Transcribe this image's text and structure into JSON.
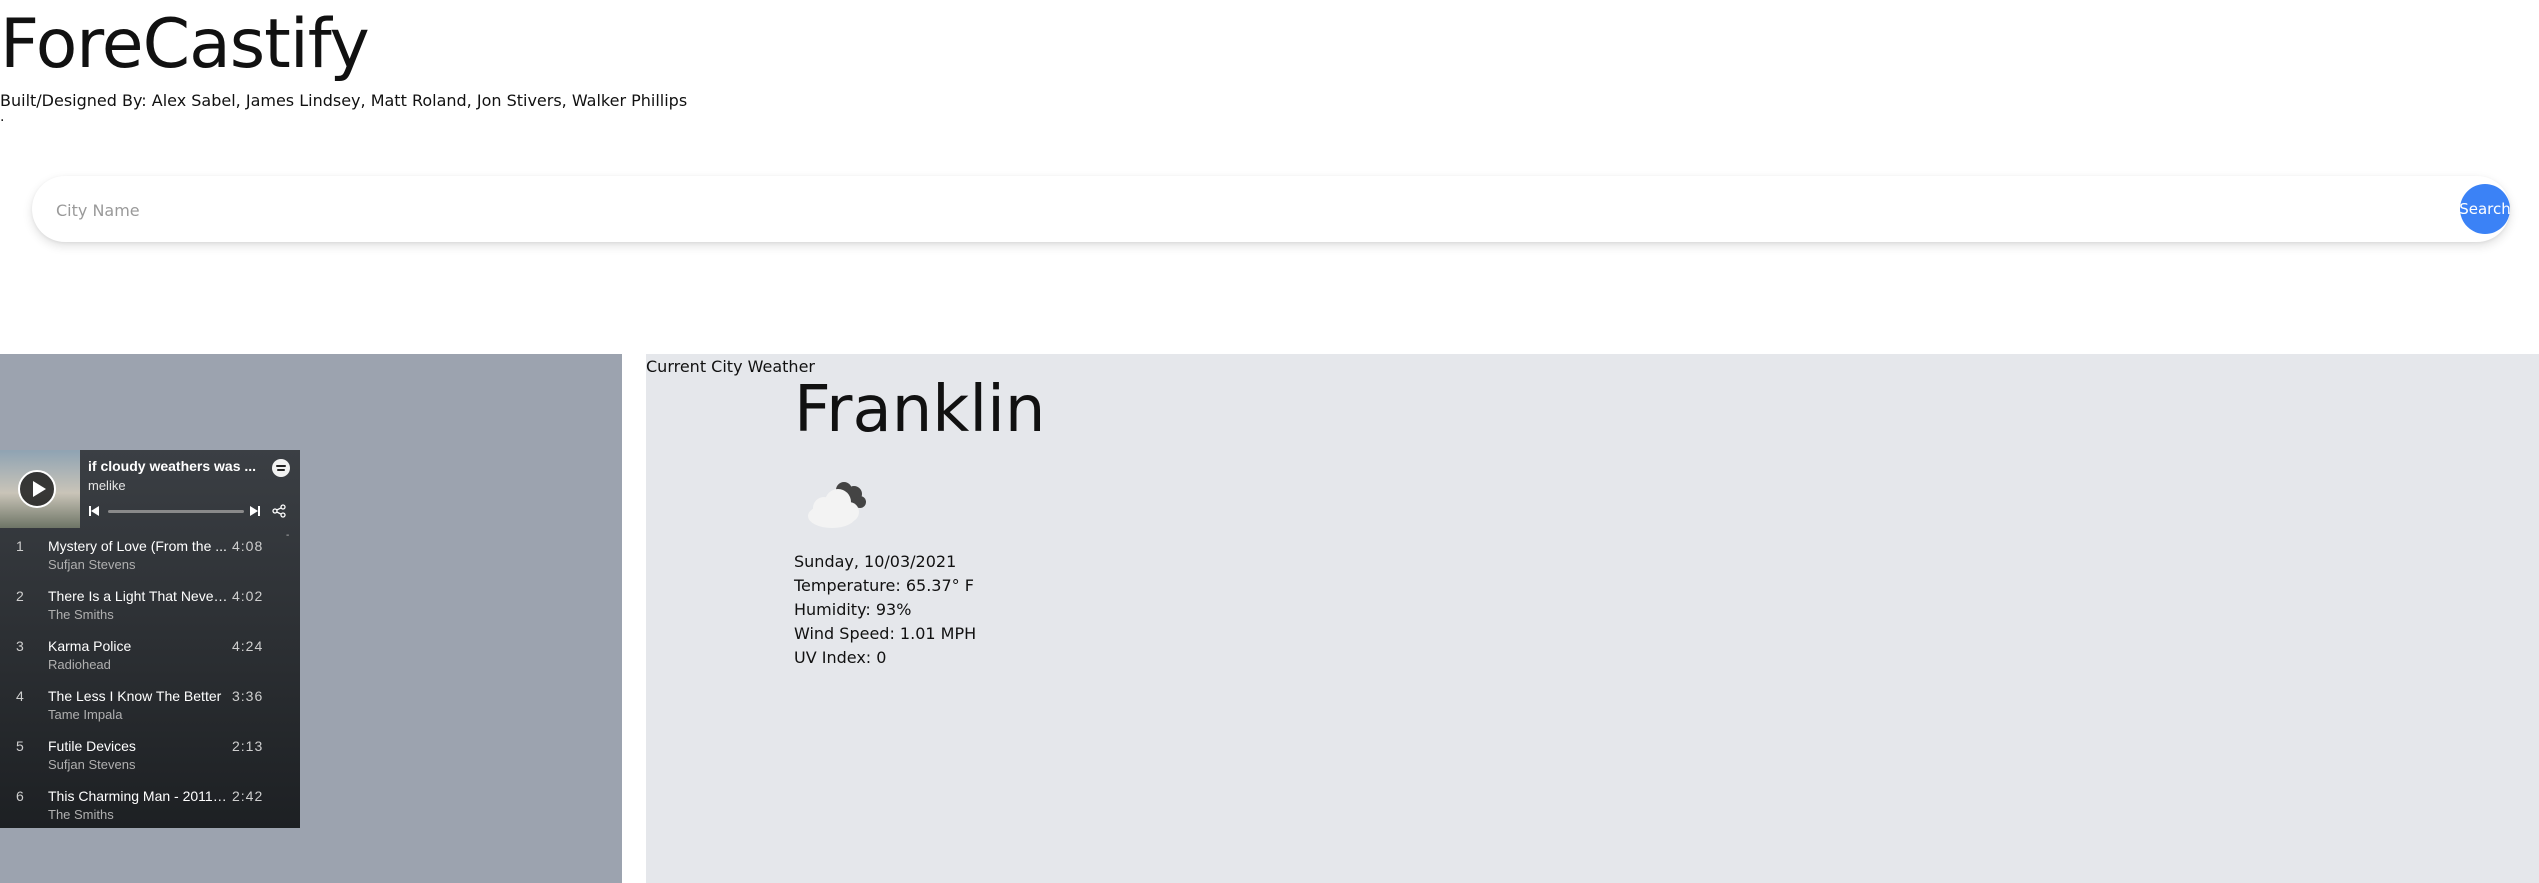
{
  "header": {
    "title": "ForeCastify",
    "credits": "Built/Designed By: Alex Sabel, James Lindsey, Matt Roland, Jon Stivers, Walker Phillips",
    "stray_mark": "."
  },
  "search": {
    "placeholder": "City Name",
    "value": "",
    "button_label": "Search",
    "button_color": "#3b82f6"
  },
  "weather": {
    "section_label": "Current City Weather",
    "city": "Franklin",
    "icon": "cloudy-icon",
    "date": "Sunday, 10/03/2021",
    "temperature": "Temperature: 65.37° F",
    "humidity": "Humidity: 93%",
    "wind_speed": "Wind Speed: 1.01 MPH",
    "uv_index": "UV Index: 0"
  },
  "spotify": {
    "playlist_title": "if cloudy weathers was ...",
    "user": "melike",
    "scroll_indicator": "-",
    "tracks": [
      {
        "num": "1",
        "title": "Mystery of Love (From the ...",
        "artist": "Sufjan Stevens",
        "duration": "4:08"
      },
      {
        "num": "2",
        "title": "There Is a Light That Never...",
        "artist": "The Smiths",
        "duration": "4:02"
      },
      {
        "num": "3",
        "title": "Karma Police",
        "artist": "Radiohead",
        "duration": "4:24"
      },
      {
        "num": "4",
        "title": "The Less I Know The Better",
        "artist": "Tame Impala",
        "duration": "3:36"
      },
      {
        "num": "5",
        "title": "Futile Devices",
        "artist": "Sufjan Stevens",
        "duration": "2:13"
      },
      {
        "num": "6",
        "title": "This Charming Man - 2011 ...",
        "artist": "The Smiths",
        "duration": "2:42"
      }
    ]
  },
  "colors": {
    "left_panel": "#9ca3af",
    "right_panel": "#e5e7eb",
    "accent": "#3b82f6"
  }
}
